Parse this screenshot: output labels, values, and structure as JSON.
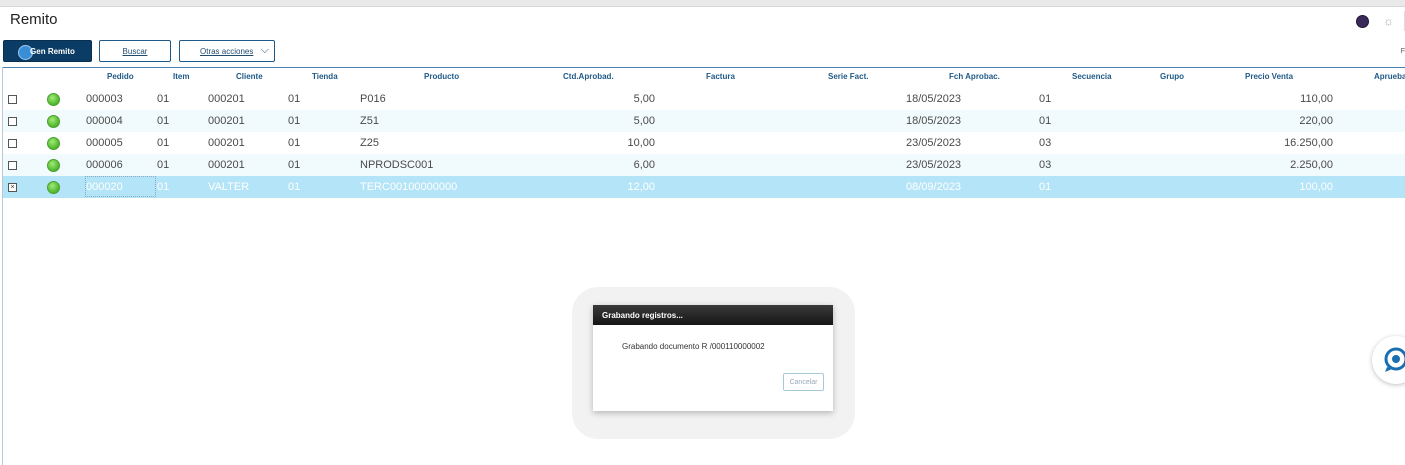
{
  "app": {
    "title": "Remito"
  },
  "toolbar": {
    "primary_label": "Gen Remito",
    "buscar_label": "Buscar",
    "otras_label": "Otras acciones",
    "right_fragment": "F"
  },
  "grid": {
    "headers": {
      "pedido": "Pedido",
      "item": "Item",
      "cliente": "Cliente",
      "tienda": "Tienda",
      "producto": "Producto",
      "ctd": "Ctd.Aprobad.",
      "factura": "Factura",
      "serie": "Serie Fact.",
      "fch": "Fch Aprobac.",
      "secuencia": "Secuencia",
      "grupo": "Grupo",
      "precio": "Precio Venta",
      "aprueba": "Aprueba"
    },
    "rows": [
      {
        "checked": "",
        "pedido": "000003",
        "item": "01",
        "cliente": "000201",
        "tienda": "01",
        "producto": "P016",
        "ctd": "5,00",
        "fch": "18/05/2023",
        "secuencia": "01",
        "precio": "110,00"
      },
      {
        "checked": "",
        "pedido": "000004",
        "item": "01",
        "cliente": "000201",
        "tienda": "01",
        "producto": "Z51",
        "ctd": "5,00",
        "fch": "18/05/2023",
        "secuencia": "01",
        "precio": "220,00"
      },
      {
        "checked": "",
        "pedido": "000005",
        "item": "01",
        "cliente": "000201",
        "tienda": "01",
        "producto": "Z25",
        "ctd": "10,00",
        "fch": "23/05/2023",
        "secuencia": "03",
        "precio": "16.250,00"
      },
      {
        "checked": "",
        "pedido": "000006",
        "item": "01",
        "cliente": "000201",
        "tienda": "01",
        "producto": "NPRODSC001",
        "ctd": "6,00",
        "fch": "23/05/2023",
        "secuencia": "03",
        "precio": "2.250,00"
      },
      {
        "checked": "×",
        "pedido": "000020",
        "item": "01",
        "cliente": "VALTER",
        "tienda": "01",
        "producto": "TERC00100000000",
        "ctd": "12,00",
        "fch": "08/09/2023",
        "secuencia": "01",
        "precio": "100,00"
      }
    ]
  },
  "dialog": {
    "title": "Grabando registros...",
    "message": "Grabando documento R /000110000002",
    "cancel_label": "Cancelar"
  },
  "icons": {
    "status": "green-status-dot-icon",
    "chat": "chat-support-icon",
    "settings": "gear-icon",
    "profile": "profile-dot-icon"
  },
  "colors": {
    "primary_button": "#0b3c66",
    "header_text": "#1f5a88",
    "selected_row": "#b4e4f8",
    "alt_row": "#f1fbfd",
    "status_green": "#5cc23a"
  }
}
